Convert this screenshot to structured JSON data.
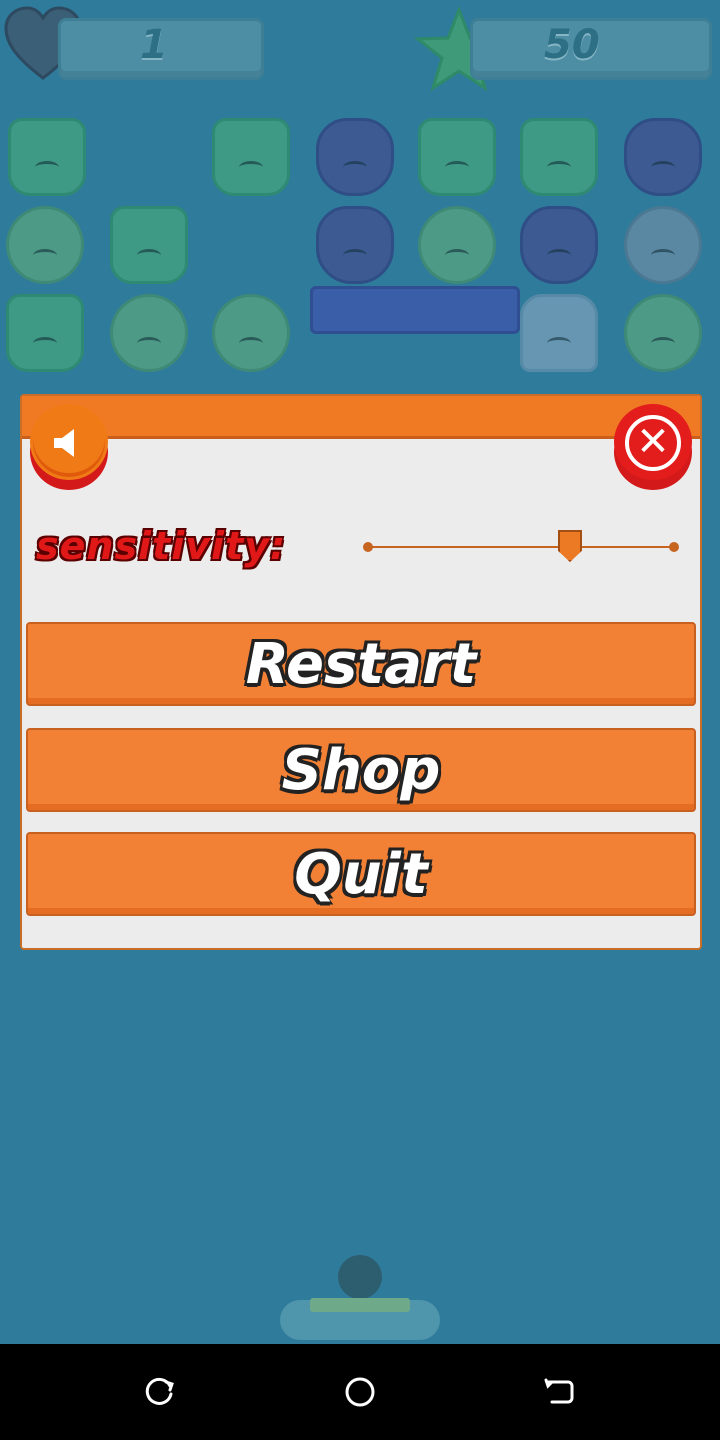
{
  "hud": {
    "lives": "1",
    "score": "50",
    "icons": [
      "heart-icon",
      "star-icon"
    ]
  },
  "settings_dialog": {
    "sound_button_icon": "speaker-icon",
    "close_button_icon": "close-icon",
    "sensitivity_label": "sensitivity:",
    "sensitivity_value": 0.66,
    "buttons": {
      "restart": "Restart",
      "shop": "Shop",
      "quit": "Quit"
    }
  },
  "nav_bar": {
    "icons": [
      "recents-icon",
      "home-icon",
      "back-icon"
    ]
  },
  "colors": {
    "dialog_orange": "#ef7a23",
    "button_orange": "#f28136",
    "close_red": "#e31c1c",
    "label_red": "#e01818",
    "game_bg": "#2e7b9b"
  }
}
